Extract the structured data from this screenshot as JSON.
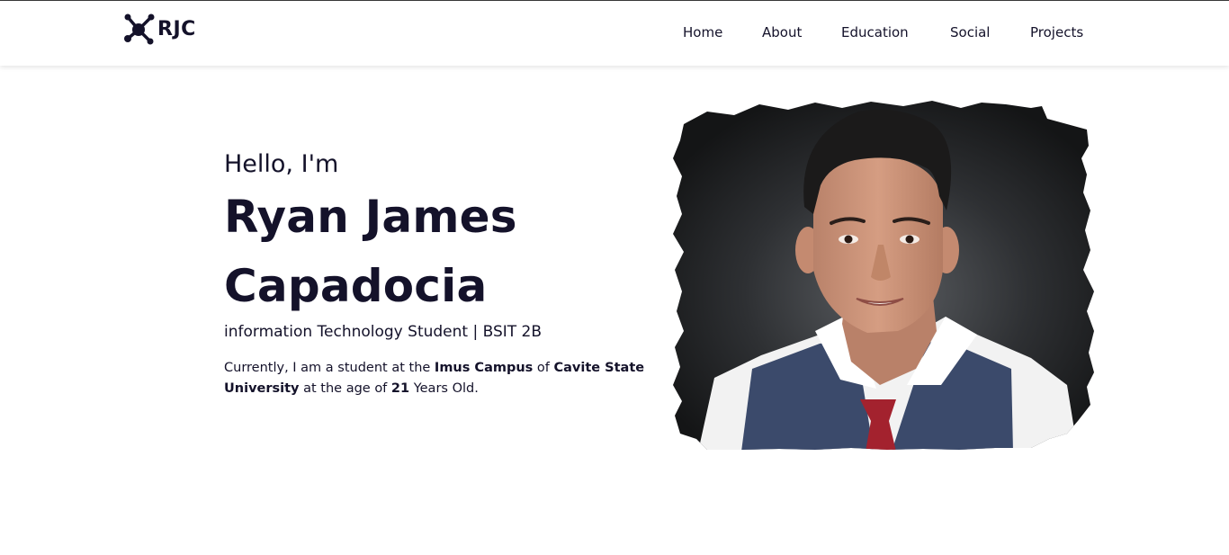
{
  "brand": {
    "name": "RJC",
    "logo_icon": "molecule-icon"
  },
  "nav": {
    "items": [
      {
        "label": "Home"
      },
      {
        "label": "About"
      },
      {
        "label": "Education"
      },
      {
        "label": "Social"
      },
      {
        "label": "Projects"
      }
    ]
  },
  "hero": {
    "greeting": "Hello, I'm",
    "name_line1": "Ryan James",
    "name_line2": "Capadocia",
    "role": "information Technology Student | BSIT 2B",
    "bio": {
      "part1": "Currently, I am a student at the ",
      "campus": "Imus Campus",
      "part2": " of ",
      "university": "Cavite State University",
      "part3": " at the age of ",
      "age": "21",
      "part4": " Years Old."
    },
    "photo_icon": "profile-photo"
  },
  "colors": {
    "text": "#14122a",
    "navbar_bg": "#ffffff",
    "photo_bg": "#2b2d30",
    "vest": "#3b4a6b",
    "tie": "#a3222e"
  }
}
